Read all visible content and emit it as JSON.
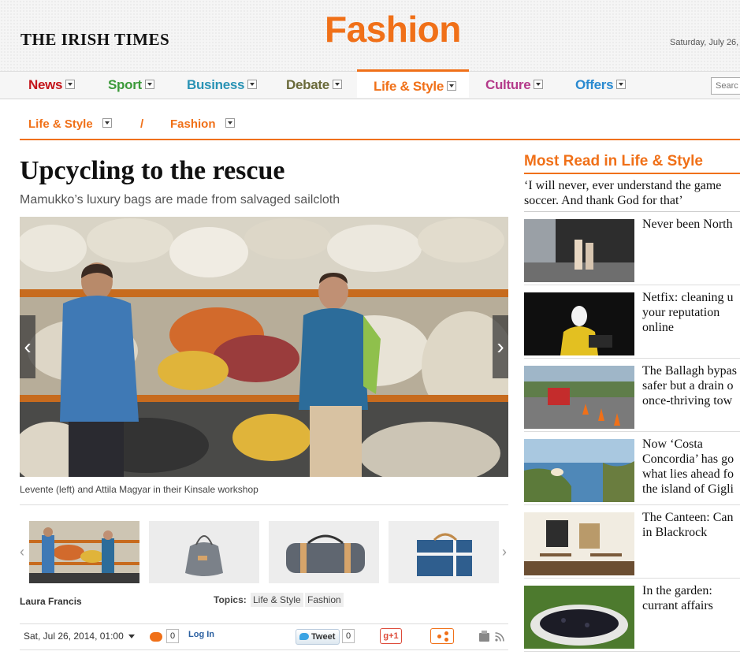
{
  "masthead": {
    "logo": "THE IRISH TIMES",
    "section_title": "Fashion",
    "date": "Saturday, July 26,"
  },
  "nav": {
    "items": [
      {
        "label": "News",
        "color": "#c4161c"
      },
      {
        "label": "Sport",
        "color": "#3c9a3a"
      },
      {
        "label": "Business",
        "color": "#2a93b5"
      },
      {
        "label": "Debate",
        "color": "#6a6a3a"
      },
      {
        "label": "Life & Style",
        "color": "#f07018"
      },
      {
        "label": "Culture",
        "color": "#b43a8a"
      },
      {
        "label": "Offers",
        "color": "#2a8ad0"
      }
    ],
    "active": "Life & Style",
    "search_placeholder": "Searc"
  },
  "breadcrumb": {
    "first": "Life & Style",
    "separator": "/",
    "second": "Fashion"
  },
  "article": {
    "headline": "Upcycling to the rescue",
    "standfirst": "Mamukko’s luxury bags are made from salvaged sailcloth",
    "caption": "Levente (left) and Attila Magyar in their Kinsale workshop",
    "prev_arrow": "‹",
    "next_arrow": "›",
    "author": "Laura Francis",
    "topics_label": "Topics:",
    "topics": [
      "Life & Style",
      "Fashion"
    ],
    "thumbnail_prev": "‹",
    "thumbnail_next": "›"
  },
  "sharebar": {
    "published": "Sat, Jul 26, 2014, 01:00",
    "comment_count": "0",
    "login": "Log In",
    "tweet_label": "Tweet",
    "tweet_count": "0",
    "gplus_label": "g+1"
  },
  "sidebar": {
    "title": "Most Read in Life & Style",
    "top_story_line1": "‘I will never, ever understand the game",
    "top_story_line2": "soccer. And thank God for that’",
    "items": [
      {
        "title": "Never been North"
      },
      {
        "title": "Netfix: cleaning u\nyour reputation\nonline"
      },
      {
        "title": "The Ballagh bypas\nsafer but a drain o\nonce-thriving tow"
      },
      {
        "title": "Now ‘Costa\nConcordia’ has go\nwhat lies ahead fo\nthe island of Gigli"
      },
      {
        "title": "The Canteen: Can\nin Blackrock"
      },
      {
        "title": "In the garden:\ncurrant affairs"
      }
    ]
  },
  "colors": {
    "accent": "#f07018",
    "link_blue": "#2a5fa0"
  }
}
